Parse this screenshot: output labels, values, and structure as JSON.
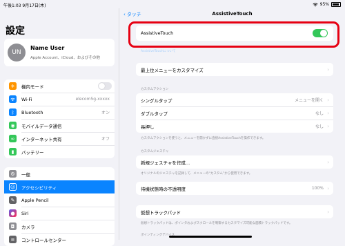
{
  "status": {
    "time": "午後1:03 9月17日(木)",
    "battery": "95%"
  },
  "sidebar": {
    "title": "設定",
    "account": {
      "initials": "UN",
      "name": "Name User",
      "subtitle": "Apple Account、iCloud、およびその他"
    },
    "network": [
      {
        "label": "機内モード",
        "icon": "airplane-icon",
        "color": "#ff9500"
      },
      {
        "label": "Wi-Fi",
        "value": "elecom5g-xxxxx",
        "icon": "wifi-icon",
        "color": "#0a84ff"
      },
      {
        "label": "Bluetooth",
        "value": "オン",
        "icon": "bluetooth-icon",
        "color": "#0a84ff"
      },
      {
        "label": "モバイルデータ通信",
        "icon": "antenna-icon",
        "color": "#34c759"
      },
      {
        "label": "インターネット共有",
        "value": "オフ",
        "icon": "link-icon",
        "color": "#34c759"
      },
      {
        "label": "バッテリー",
        "icon": "battery-icon",
        "color": "#34c759"
      }
    ],
    "general": [
      {
        "label": "一般",
        "icon": "gear-icon",
        "color": "#8e8e93"
      },
      {
        "label": "アクセシビリティ",
        "icon": "accessibility-icon",
        "color": "#0a84ff"
      },
      {
        "label": "Apple Pencil",
        "icon": "pencil-icon",
        "color": "#636366"
      },
      {
        "label": "Siri",
        "icon": "siri-icon",
        "color": "#5e5ce6"
      },
      {
        "label": "カメラ",
        "icon": "camera-icon",
        "color": "#8e8e93"
      },
      {
        "label": "コントロールセンター",
        "icon": "control-center-icon",
        "color": "#636366"
      }
    ]
  },
  "main": {
    "back_label": "タッチ",
    "title": "AssistiveTouch",
    "assistive_label": "AssistiveTouch",
    "top_menu_label": "最上位メニューをカスタマイズ",
    "custom_action_header": "カスタムアクション",
    "actions": [
      {
        "label": "シングルタップ",
        "value": "メニューを開く"
      },
      {
        "label": "ダブルタップ",
        "value": "なし"
      },
      {
        "label": "長押し",
        "value": "なし"
      }
    ],
    "custom_action_note": "カスタムアクションを使うと、メニューを開かずに直接AssistiveTouchを操作できます。",
    "custom_gesture_header": "カスタムジェスチャ",
    "new_gesture_label": "新規ジェスチャを作成...",
    "gesture_note": "オリジナルのジェスチャを記録して、メニューの“カスタム”から使用できます。",
    "idle_opacity_label": "待機状態時の不透明度",
    "idle_opacity_value": "100%",
    "trackpad_label": "仮想トラックパッド",
    "trackpad_note": "仮想トラックパッドは、ポインタおよびスクロールを制御するカスタマイズ可能な面積トラックパッドです。",
    "pointing_header": "ポインティングデバイス",
    "link_text": "AssistiveTouchについて"
  }
}
